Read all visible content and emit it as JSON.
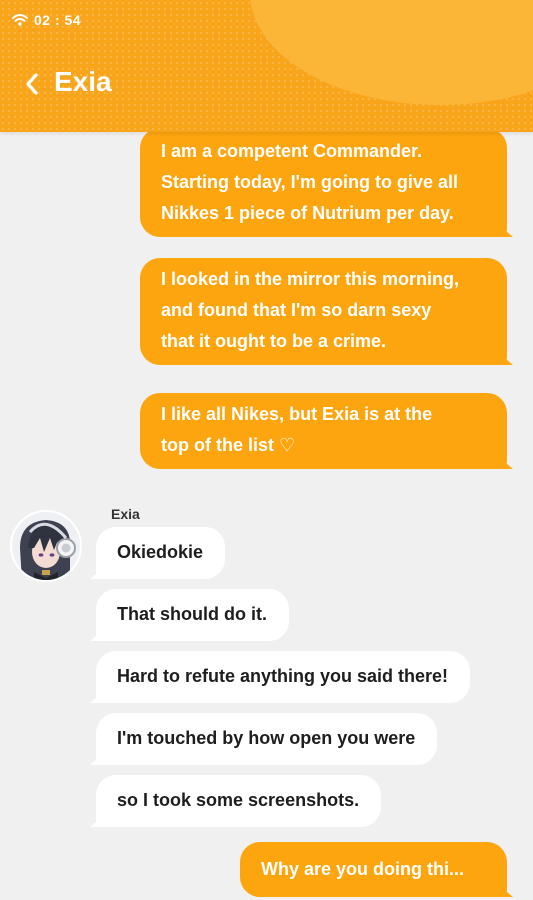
{
  "status": {
    "time": "02 : 54"
  },
  "header": {
    "title": "Exia",
    "accent": "#f9a51c"
  },
  "sender": {
    "name": "Exia"
  },
  "messages_out": [
    {
      "lines": [
        "I am a competent Commander.",
        "Starting today, I'm going to give all",
        "Nikkes 1 piece of Nutrium per day."
      ]
    },
    {
      "lines": [
        "I looked in the mirror this morning,",
        "and found that I'm so darn sexy",
        "that it ought to be a crime."
      ]
    },
    {
      "lines": [
        "I like all Nikes, but Exia is at the",
        "top of the list ♡"
      ]
    }
  ],
  "messages_in": [
    {
      "text": "Okiedokie"
    },
    {
      "text": "That should do it."
    },
    {
      "text": "Hard to refute anything you said there!"
    },
    {
      "text": "I'm touched by how open you were"
    },
    {
      "text": "so I took some screenshots."
    }
  ],
  "reply_option": {
    "text": "Why are you doing thi..."
  }
}
